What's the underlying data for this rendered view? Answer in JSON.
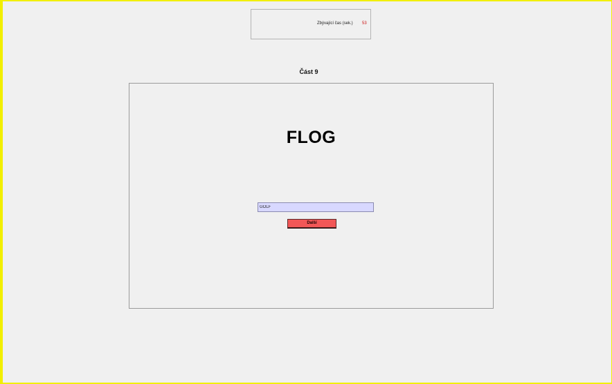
{
  "timer": {
    "label": "Zbývající čas (sek.)",
    "value": "53"
  },
  "section": {
    "title": "Část 9"
  },
  "task": {
    "word": "FLOG",
    "answer_value": "GOLF",
    "next_label": "Další"
  },
  "colors": {
    "frame_border": "#f2ef00",
    "timer_value": "#cc1111",
    "input_background": "#d8d8ff",
    "button_background": "#f25757",
    "page_background": "#f0f0f0"
  }
}
